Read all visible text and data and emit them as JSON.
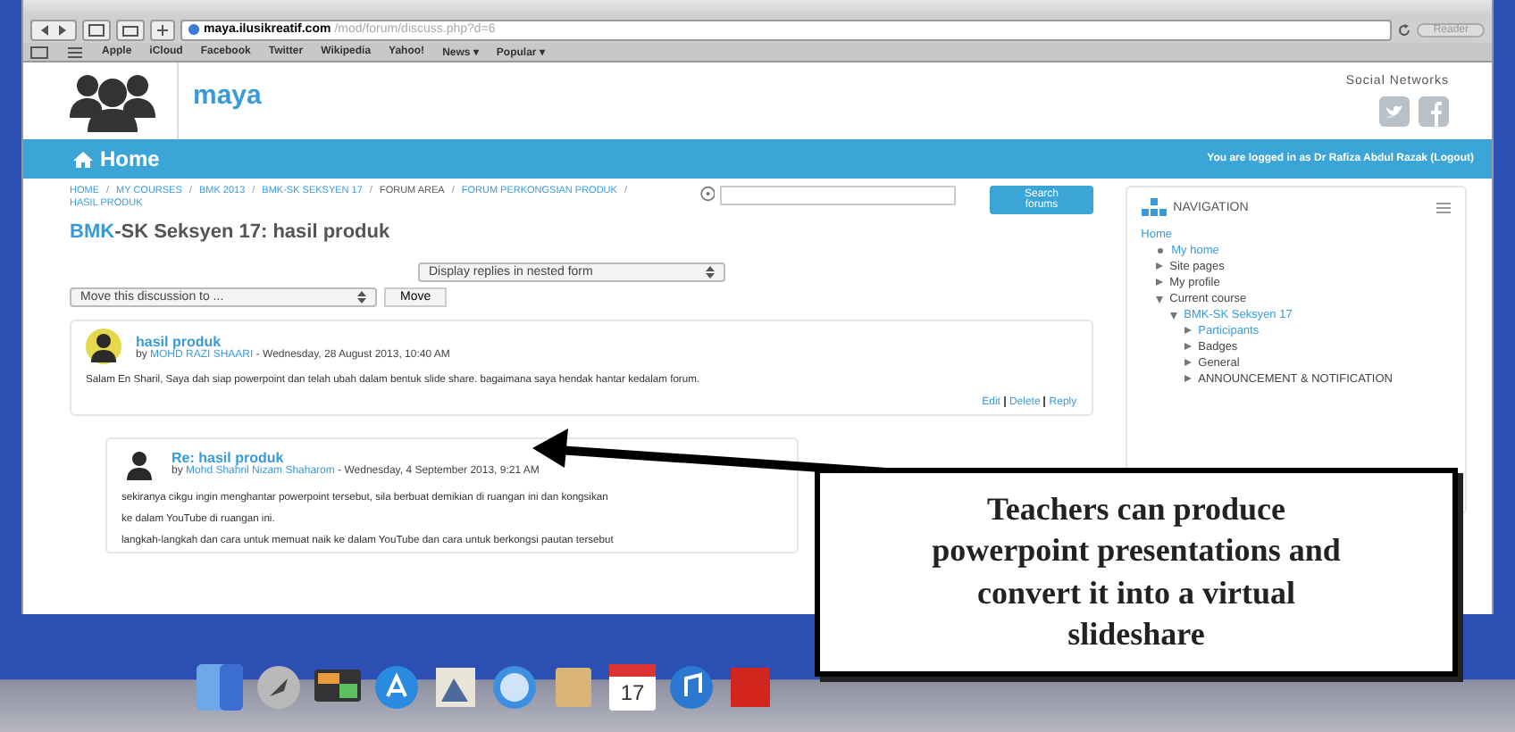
{
  "browser": {
    "url_host": "maya.ilusikreatif.com",
    "url_path": "/mod/forum/discuss.php?d=6",
    "reader": "Reader",
    "bookmarks": [
      "Apple",
      "iCloud",
      "Facebook",
      "Twitter",
      "Wikipedia",
      "Yahoo!",
      "News ▾",
      "Popular ▾"
    ]
  },
  "site": {
    "name": "maya",
    "social_label": "Social Networks"
  },
  "navbar": {
    "home": "Home",
    "login_text": "You are logged in as Dr Rafiza Abdul Razak (Logout)"
  },
  "breadcrumb_separator": "/",
  "breadcrumb": [
    "HOME",
    "MY COURSES",
    "BMK 2013",
    "BMK-SK SEKSYEN 17",
    "FORUM AREA",
    "FORUM PERKONGSIAN PRODUK",
    "HASIL PRODUK"
  ],
  "search_button": "Search forums",
  "page_title": {
    "course": "BMK",
    "rest": "-SK Seksyen 17: hasil produk"
  },
  "display_select": "Display replies in nested form",
  "move_select": "Move this discussion to ...",
  "move_button": "Move",
  "posts": [
    {
      "subject": "hasil produk",
      "by": "by",
      "author": "MOHD RAZI SHAARI",
      "date": "- Wednesday, 28 August 2013, 10:40 AM",
      "paragraphs": [
        "Salam En Sharil, Saya dah siap powerpoint dan telah ubah dalam bentuk slide share. bagaimana saya hendak hantar kedalam forum."
      ],
      "actions": [
        "Edit",
        "Delete",
        "Reply"
      ]
    },
    {
      "subject": "Re: hasil produk",
      "by": "by",
      "author": "Mohd Shahril Nizam Shaharom",
      "date": "- Wednesday, 4 September 2013, 9:21 AM",
      "paragraphs": [
        "sekiranya cikgu ingin menghantar powerpoint tersebut, sila berbuat demikian di ruangan ini dan kongsikan",
        "ke dalam YouTube di ruangan ini.",
        "langkah-langkah dan cara untuk memuat naik ke dalam YouTube dan cara untuk berkongsi pautan tersebut"
      ]
    }
  ],
  "navigation": {
    "title": "NAVIGATION",
    "home": "Home",
    "items": [
      {
        "label": "My home",
        "kind": "leaf",
        "link": true
      },
      {
        "label": "Site pages",
        "kind": "branch",
        "expanded": false,
        "link": false
      },
      {
        "label": "My profile",
        "kind": "branch",
        "expanded": false,
        "link": false
      },
      {
        "label": "Current course",
        "kind": "branch",
        "expanded": true,
        "link": false,
        "children": [
          {
            "label": "BMK-SK Seksyen 17",
            "kind": "branch",
            "expanded": true,
            "link": true,
            "children": [
              {
                "label": "Participants",
                "kind": "branch",
                "expanded": false,
                "link": true
              },
              {
                "label": "Badges",
                "kind": "branch",
                "expanded": false,
                "link": false
              },
              {
                "label": "General",
                "kind": "branch",
                "expanded": false,
                "link": false
              },
              {
                "label": "ANNOUNCEMENT & NOTIFICATION",
                "kind": "branch",
                "expanded": false,
                "link": false
              }
            ]
          }
        ]
      }
    ]
  },
  "dock": {
    "calendar_day": "17"
  },
  "callout": {
    "text": "Teachers can produce powerpoint presentations and convert it  into a virtual slideshare"
  }
}
